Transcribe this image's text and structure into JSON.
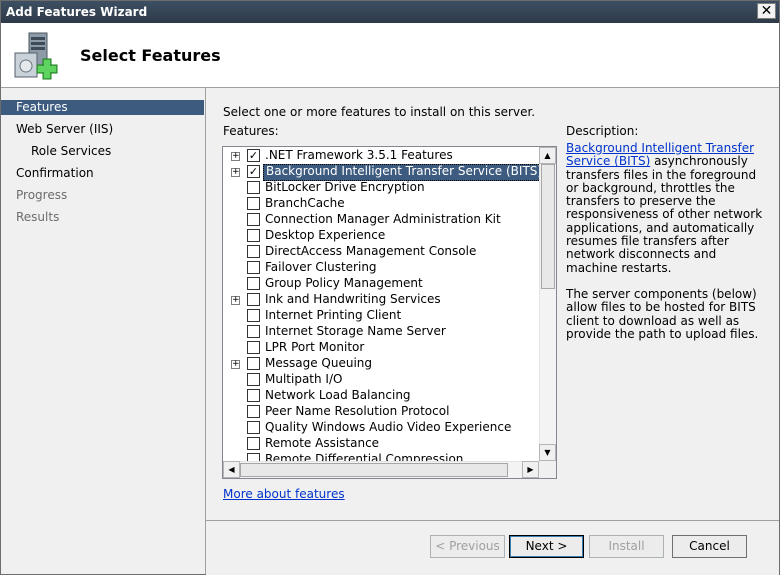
{
  "window": {
    "title": "Add Features Wizard",
    "close_glyph": "✕"
  },
  "header": {
    "title": "Select Features",
    "icon": "server-add-icon"
  },
  "nav": {
    "items": [
      {
        "label": "Features",
        "state": "selected"
      },
      {
        "label": "Web Server (IIS)",
        "state": "normal"
      },
      {
        "label": "Role Services",
        "state": "normal"
      },
      {
        "label": "Confirmation",
        "state": "normal"
      },
      {
        "label": "Progress",
        "state": "disabled"
      },
      {
        "label": "Results",
        "state": "disabled"
      }
    ]
  },
  "main": {
    "instruction": "Select one or more features to install on this server.",
    "features_label": "Features:",
    "description_label": "Description:",
    "more_link": "More about features",
    "features": [
      {
        "label": ".NET Framework 3.5.1 Features",
        "expandable": true,
        "checked": true,
        "selected": false
      },
      {
        "label": "Background Intelligent Transfer Service (BITS)",
        "expandable": true,
        "checked": true,
        "selected": true
      },
      {
        "label": "BitLocker Drive Encryption",
        "expandable": false,
        "checked": false,
        "selected": false
      },
      {
        "label": "BranchCache",
        "expandable": false,
        "checked": false,
        "selected": false
      },
      {
        "label": "Connection Manager Administration Kit",
        "expandable": false,
        "checked": false,
        "selected": false
      },
      {
        "label": "Desktop Experience",
        "expandable": false,
        "checked": false,
        "selected": false
      },
      {
        "label": "DirectAccess Management Console",
        "expandable": false,
        "checked": false,
        "selected": false
      },
      {
        "label": "Failover Clustering",
        "expandable": false,
        "checked": false,
        "selected": false
      },
      {
        "label": "Group Policy Management",
        "expandable": false,
        "checked": false,
        "selected": false
      },
      {
        "label": "Ink and Handwriting Services",
        "expandable": true,
        "checked": false,
        "selected": false
      },
      {
        "label": "Internet Printing Client",
        "expandable": false,
        "checked": false,
        "selected": false
      },
      {
        "label": "Internet Storage Name Server",
        "expandable": false,
        "checked": false,
        "selected": false
      },
      {
        "label": "LPR Port Monitor",
        "expandable": false,
        "checked": false,
        "selected": false
      },
      {
        "label": "Message Queuing",
        "expandable": true,
        "checked": false,
        "selected": false
      },
      {
        "label": "Multipath I/O",
        "expandable": false,
        "checked": false,
        "selected": false
      },
      {
        "label": "Network Load Balancing",
        "expandable": false,
        "checked": false,
        "selected": false
      },
      {
        "label": "Peer Name Resolution Protocol",
        "expandable": false,
        "checked": false,
        "selected": false
      },
      {
        "label": "Quality Windows Audio Video Experience",
        "expandable": false,
        "checked": false,
        "selected": false
      },
      {
        "label": "Remote Assistance",
        "expandable": false,
        "checked": false,
        "selected": false
      },
      {
        "label": "Remote Differential Compression",
        "expandable": false,
        "checked": false,
        "selected": false
      }
    ],
    "description": {
      "link_text": "Background Intelligent Transfer Service (BITS)",
      "text1": " asynchronously transfers files in the foreground or background, throttles the transfers to preserve the responsiveness of other network applications, and automatically resumes file transfers after network disconnects and machine restarts.",
      "text2": "The server components (below) allow files to be hosted for BITS client to download as well as provide the path to upload files."
    }
  },
  "footer": {
    "previous": "< Previous",
    "next": "Next >",
    "install": "Install",
    "cancel": "Cancel"
  }
}
